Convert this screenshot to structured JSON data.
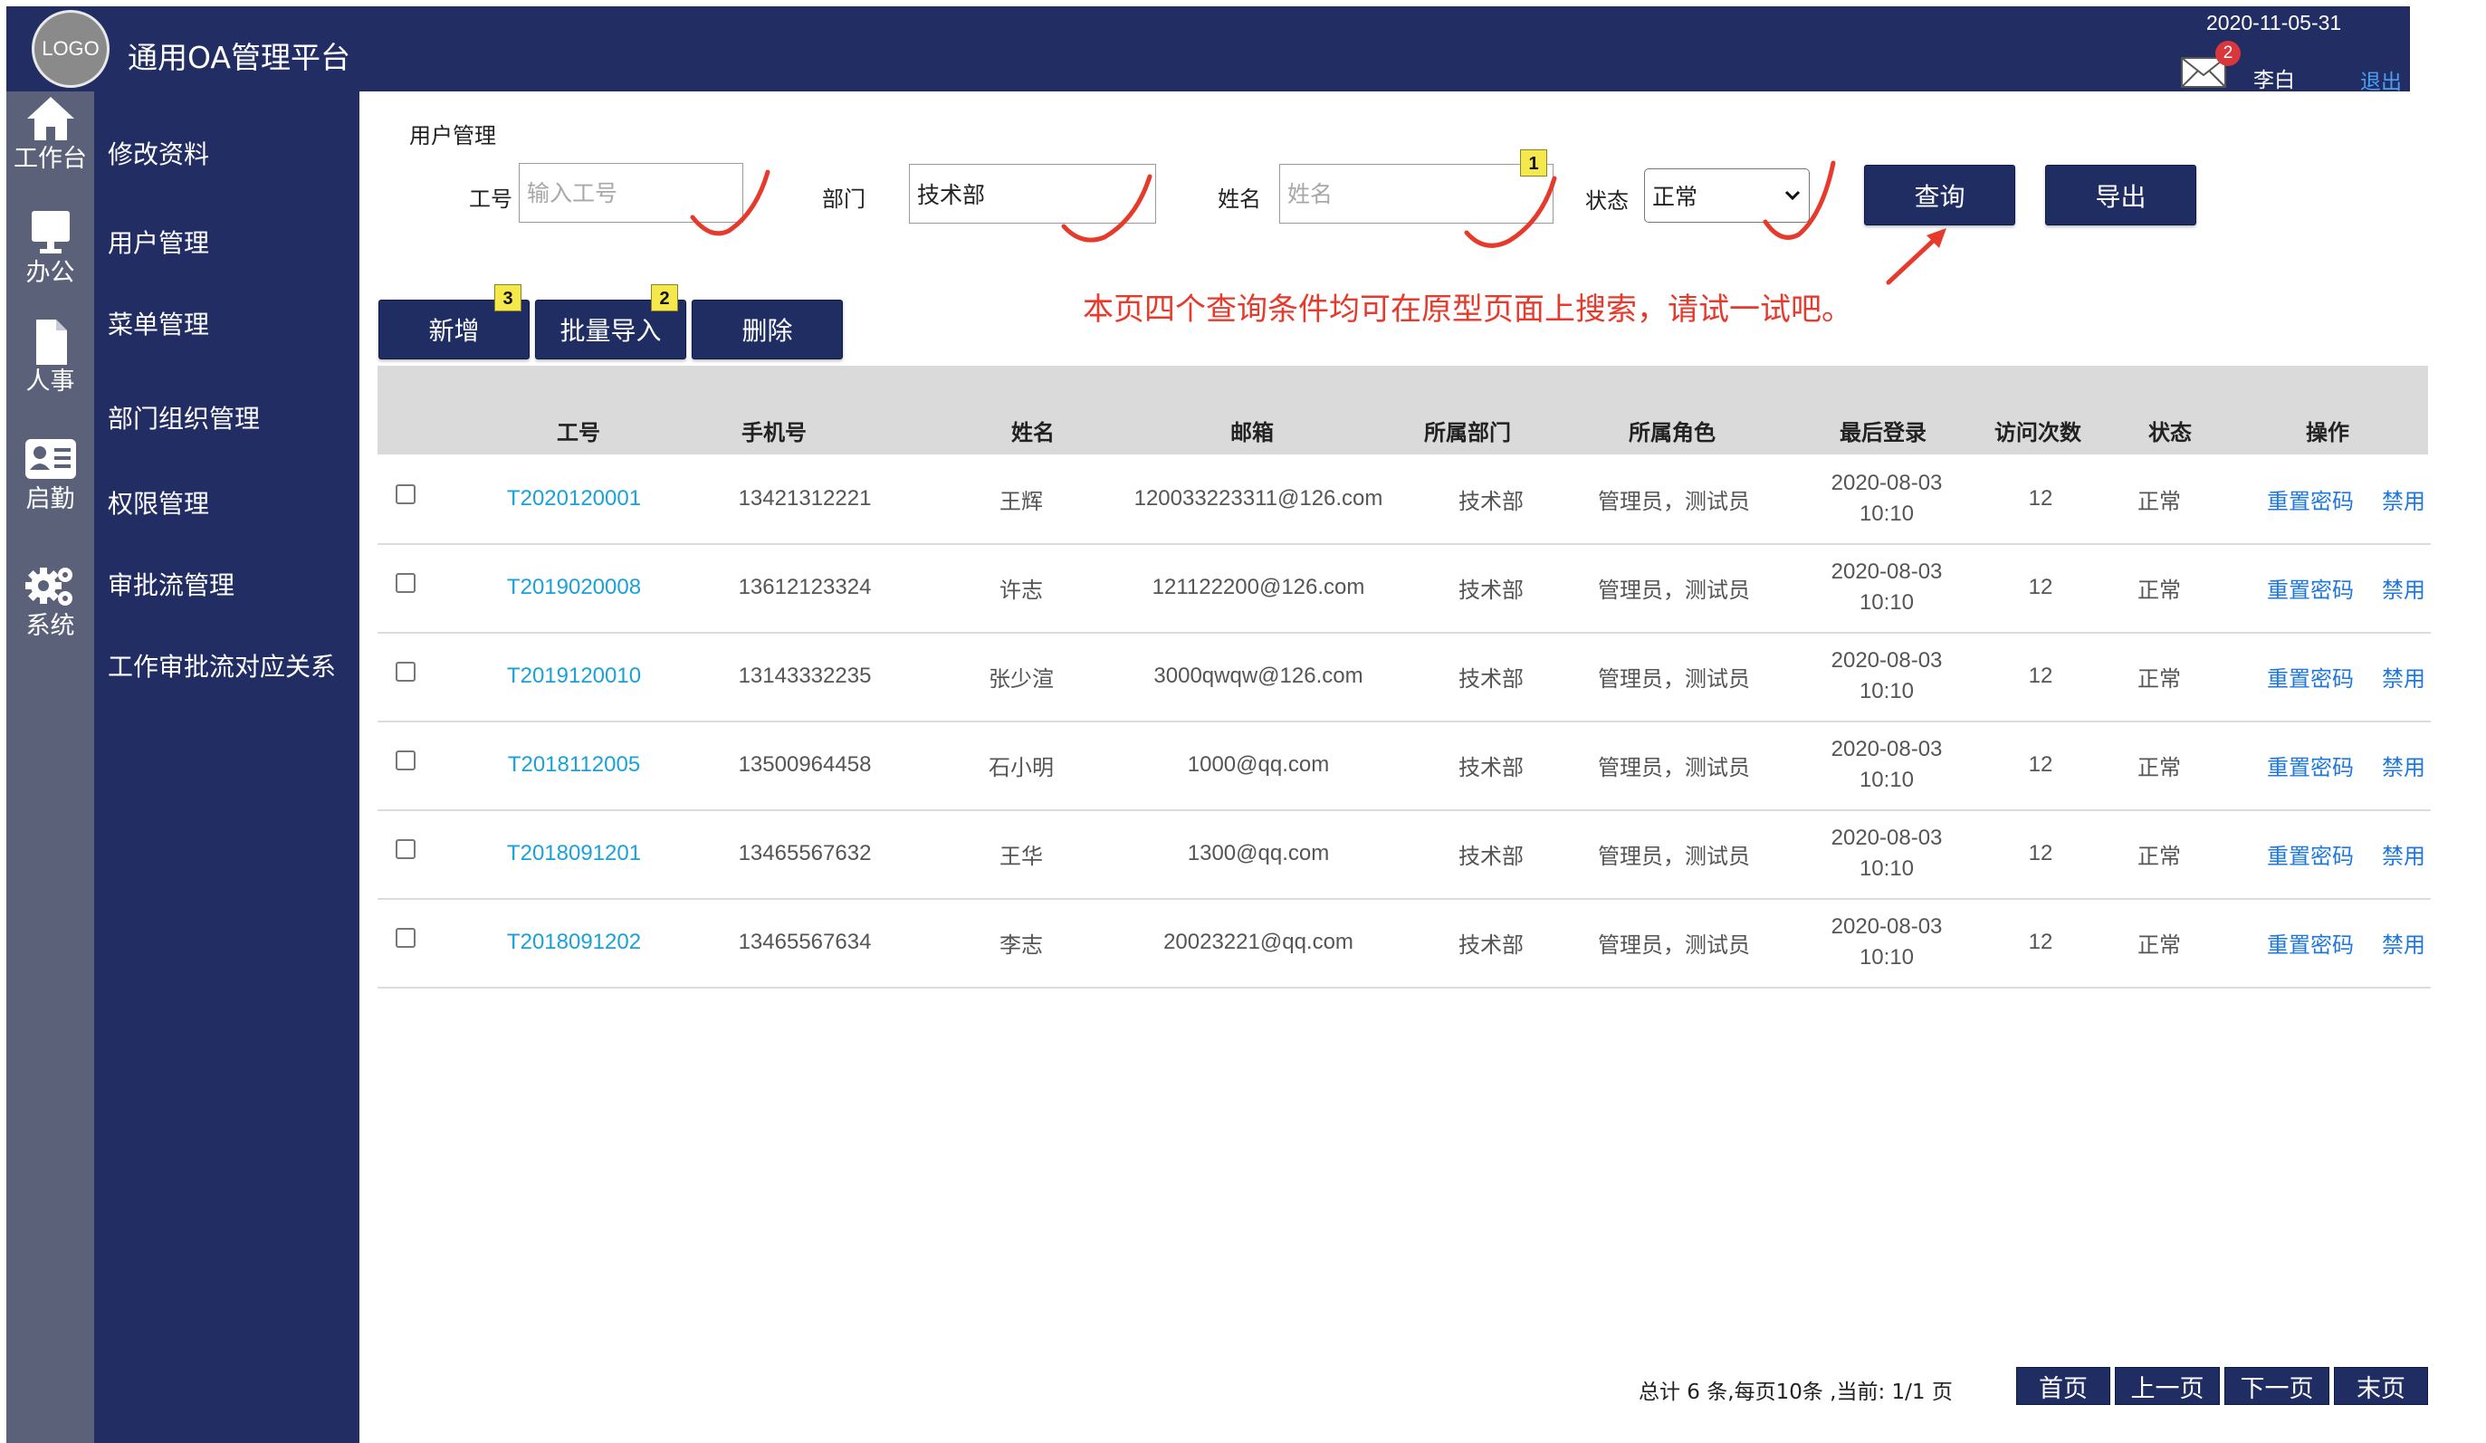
{
  "header": {
    "logo_text": "LOGO",
    "title": "通用OA管理平台",
    "date": "2020-11-05-31",
    "mail_count": "2",
    "user": "李白",
    "logout": "退出"
  },
  "rail": [
    {
      "label": "工作台",
      "icon": "home-icon"
    },
    {
      "label": "办公",
      "icon": "monitor-icon"
    },
    {
      "label": "人事",
      "icon": "document-icon"
    },
    {
      "label": "启勤",
      "icon": "id-card-icon"
    },
    {
      "label": "系统",
      "icon": "gears-icon"
    }
  ],
  "menu": [
    "修改资料",
    "用户管理",
    "菜单管理",
    "部门组织管理",
    "权限管理",
    "审批流管理",
    "工作审批流对应关系"
  ],
  "breadcrumb": "用户管理",
  "filters": {
    "emp_no_label": "工号",
    "emp_no_placeholder": "输入工号",
    "dept_label": "部门",
    "dept_value": "技术部",
    "name_label": "姓名",
    "name_placeholder": "姓名",
    "status_label": "状态",
    "status_value": "正常",
    "query_button": "查询",
    "export_button": "导出"
  },
  "actions": {
    "add": "新增",
    "import": "批量导入",
    "delete": "删除"
  },
  "badges": {
    "name_field": "1",
    "import": "2",
    "add": "3"
  },
  "hint": "本页四个查询条件均可在原型页面上搜索，请试一试吧。",
  "table": {
    "columns": [
      "工号",
      "手机号",
      "姓名",
      "邮箱",
      "所属部门",
      "所属角色",
      "最后登录",
      "访问次数",
      "状态",
      "操作"
    ],
    "rows": [
      {
        "id": "T2020120001",
        "phone": "13421312221",
        "name": "王辉",
        "email": "120033223311@126.com",
        "dept": "技术部",
        "roles": "管理员，测试员",
        "login_date": "2020-08-03",
        "login_time": "10:10",
        "visits": "12",
        "status": "正常",
        "reset": "重置密码",
        "disable": "禁用"
      },
      {
        "id": "T2019020008",
        "phone": "13612123324",
        "name": "许志",
        "email": "121122200@126.com",
        "dept": "技术部",
        "roles": "管理员，测试员",
        "login_date": "2020-08-03",
        "login_time": "10:10",
        "visits": "12",
        "status": "正常",
        "reset": "重置密码",
        "disable": "禁用"
      },
      {
        "id": "T2019120010",
        "phone": "13143332235",
        "name": "张少渲",
        "email": "3000qwqw@126.com",
        "dept": "技术部",
        "roles": "管理员，测试员",
        "login_date": "2020-08-03",
        "login_time": "10:10",
        "visits": "12",
        "status": "正常",
        "reset": "重置密码",
        "disable": "禁用"
      },
      {
        "id": "T2018112005",
        "phone": "13500964458",
        "name": "石小明",
        "email": "1000@qq.com",
        "dept": "技术部",
        "roles": "管理员，测试员",
        "login_date": "2020-08-03",
        "login_time": "10:10",
        "visits": "12",
        "status": "正常",
        "reset": "重置密码",
        "disable": "禁用"
      },
      {
        "id": "T2018091201",
        "phone": "13465567632",
        "name": "王华",
        "email": "1300@qq.com",
        "dept": "技术部",
        "roles": "管理员，测试员",
        "login_date": "2020-08-03",
        "login_time": "10:10",
        "visits": "12",
        "status": "正常",
        "reset": "重置密码",
        "disable": "禁用"
      },
      {
        "id": "T2018091202",
        "phone": "13465567634",
        "name": "李志",
        "email": "20023221@qq.com",
        "dept": "技术部",
        "roles": "管理员，测试员",
        "login_date": "2020-08-03",
        "login_time": "10:10",
        "visits": "12",
        "status": "正常",
        "reset": "重置密码",
        "disable": "禁用"
      }
    ]
  },
  "pagination": {
    "summary": "总计 6 条,每页10条 ,当前: 1/1 页",
    "first": "首页",
    "prev": "上一页",
    "next": "下一页",
    "last": "末页"
  },
  "colors": {
    "navy": "#222d63",
    "rail": "#5a6178",
    "hint_red": "#e53a2c",
    "link_cyan": "#1aa1d8",
    "op_blue": "#1f78e0"
  }
}
